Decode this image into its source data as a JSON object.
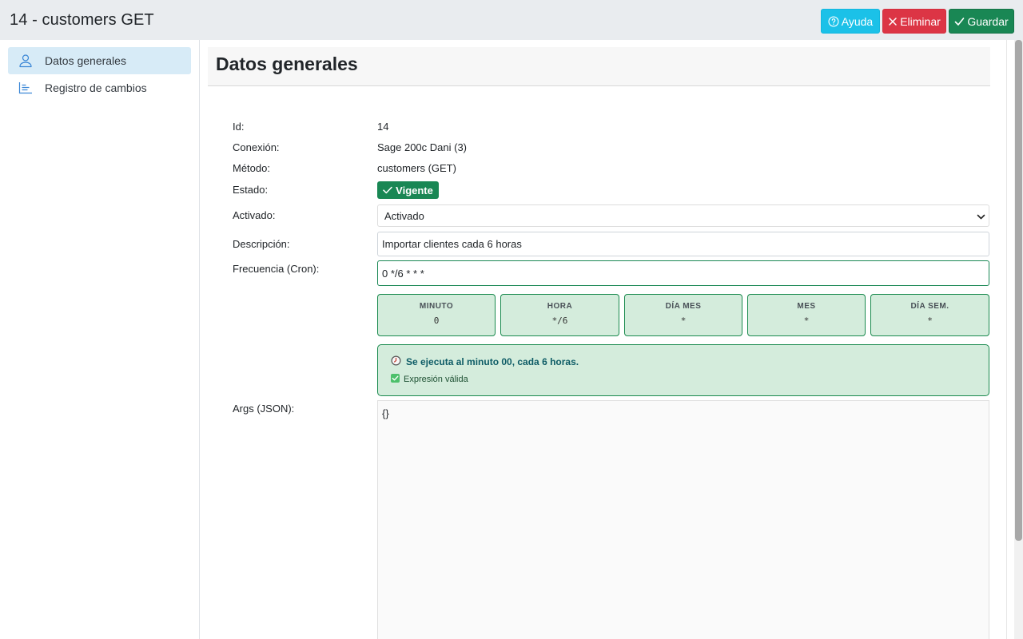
{
  "header": {
    "title": "14 - customers GET",
    "help_label": "Ayuda",
    "delete_label": "Eliminar",
    "save_label": "Guardar"
  },
  "sidebar": {
    "items": [
      {
        "label": "Datos generales",
        "icon": "user-icon",
        "active": true
      },
      {
        "label": "Registro de cambios",
        "icon": "list-chart-icon",
        "active": false
      }
    ]
  },
  "section": {
    "title": "Datos generales"
  },
  "fields": {
    "id_label": "Id:",
    "id_value": "14",
    "conexion_label": "Conexión:",
    "conexion_value": "Sage 200c Dani (3)",
    "metodo_label": "Método:",
    "metodo_value": "customers (GET)",
    "estado_label": "Estado:",
    "estado_value": "Vigente",
    "activado_label": "Activado:",
    "activado_value": "Activado",
    "descripcion_label": "Descripción:",
    "descripcion_value": "Importar clientes cada 6 horas",
    "cron_label": "Frecuencia (Cron):",
    "cron_value": "0 */6 * * *",
    "args_label": "Args (JSON):",
    "args_value": "{}"
  },
  "cron_parts": [
    {
      "header": "MINUTO",
      "value": "0"
    },
    {
      "header": "HORA",
      "value": "*/6"
    },
    {
      "header": "DÍA MES",
      "value": "*"
    },
    {
      "header": "MES",
      "value": "*"
    },
    {
      "header": "DÍA SEM.",
      "value": "*"
    }
  ],
  "cron_info": {
    "summary": "Se ejecuta al minuto 00, cada 6 horas.",
    "validity": "Expresión válida"
  },
  "colors": {
    "success": "#198754",
    "danger": "#dc3545",
    "info": "#1bc1e8",
    "cron_bg": "#d4ecdc"
  }
}
